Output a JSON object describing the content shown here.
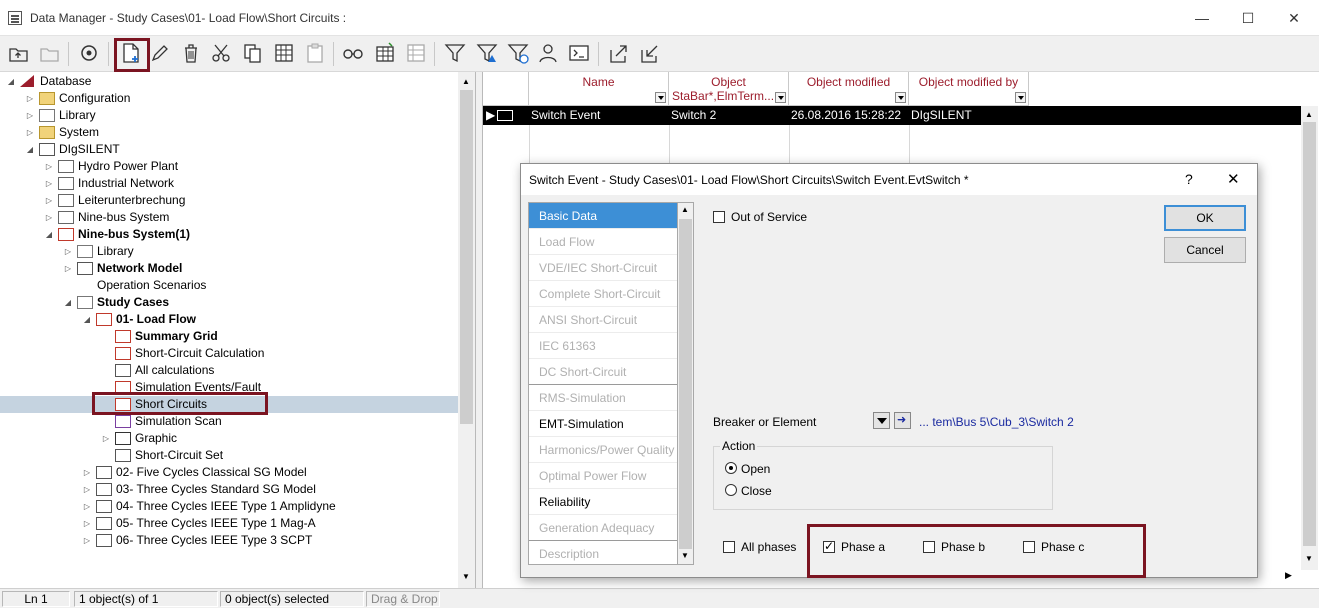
{
  "window": {
    "title": "Data Manager - Study Cases\\01- Load Flow\\Short Circuits :",
    "minimize": "—",
    "maximize": "☐",
    "close": "✕"
  },
  "toolbar_icons": [
    "folder-up-icon",
    "new-folder-icon",
    "refresh-icon",
    "new-object-icon",
    "edit-icon",
    "delete-icon",
    "cut-icon",
    "copy-icon",
    "paste-table-icon",
    "paste-icon",
    "glasses-icon",
    "table-icon",
    "grid-icon",
    "filter-icon",
    "filter-warning-icon",
    "filter-clock-icon",
    "users-icon",
    "terminal-icon",
    "export-icon",
    "import-icon"
  ],
  "tree": [
    {
      "label": "Database",
      "indent": 0,
      "expanded": true,
      "bold": false,
      "icon": "database-icon"
    },
    {
      "label": "Configuration",
      "indent": 1,
      "expanded": false,
      "bold": false,
      "icon": "folder-icon"
    },
    {
      "label": "Library",
      "indent": 1,
      "expanded": false,
      "bold": false,
      "icon": "library-icon"
    },
    {
      "label": "System",
      "indent": 1,
      "expanded": false,
      "bold": false,
      "icon": "folder-icon"
    },
    {
      "label": "DIgSILENT",
      "indent": 1,
      "expanded": true,
      "bold": false,
      "icon": "user-icon"
    },
    {
      "label": "Hydro Power Plant",
      "indent": 2,
      "expanded": false,
      "bold": false,
      "icon": "project-icon"
    },
    {
      "label": "Industrial Network",
      "indent": 2,
      "expanded": false,
      "bold": false,
      "icon": "project-icon"
    },
    {
      "label": "Leiterunterbrechung",
      "indent": 2,
      "expanded": false,
      "bold": false,
      "icon": "project-icon"
    },
    {
      "label": "Nine-bus System",
      "indent": 2,
      "expanded": false,
      "bold": false,
      "icon": "project-icon"
    },
    {
      "label": "Nine-bus System(1)",
      "indent": 2,
      "expanded": true,
      "bold": true,
      "icon": "active-project-icon"
    },
    {
      "label": "Library",
      "indent": 3,
      "expanded": false,
      "bold": false,
      "icon": "library-icon"
    },
    {
      "label": "Network Model",
      "indent": 3,
      "expanded": false,
      "bold": true,
      "icon": "network-model-icon"
    },
    {
      "label": "Operation Scenarios",
      "indent": 3,
      "expanded": null,
      "bold": false,
      "icon": "none"
    },
    {
      "label": "Study Cases",
      "indent": 3,
      "expanded": true,
      "bold": true,
      "icon": "study-cases-icon"
    },
    {
      "label": "01- Load Flow",
      "indent": 4,
      "expanded": true,
      "bold": true,
      "icon": "active-study-case-icon"
    },
    {
      "label": "Summary Grid",
      "indent": 5,
      "expanded": null,
      "bold": true,
      "icon": "summary-grid-icon"
    },
    {
      "label": "Short-Circuit Calculation",
      "indent": 5,
      "expanded": null,
      "bold": false,
      "icon": "short-circuit-icon"
    },
    {
      "label": "All calculations",
      "indent": 5,
      "expanded": null,
      "bold": false,
      "icon": "calculations-icon"
    },
    {
      "label": "Simulation Events/Fault",
      "indent": 5,
      "expanded": null,
      "bold": false,
      "icon": "events-icon"
    },
    {
      "label": "Short Circuits",
      "indent": 5,
      "expanded": null,
      "bold": false,
      "icon": "events-icon",
      "selected": true
    },
    {
      "label": "Simulation Scan",
      "indent": 5,
      "expanded": null,
      "bold": false,
      "icon": "scan-icon"
    },
    {
      "label": "Graphic",
      "indent": 5,
      "expanded": false,
      "bold": false,
      "icon": "graphic-icon"
    },
    {
      "label": "Short-Circuit Set",
      "indent": 5,
      "expanded": null,
      "bold": false,
      "icon": "set-icon"
    },
    {
      "label": "02- Five Cycles Classical SG Model",
      "indent": 4,
      "expanded": false,
      "bold": false,
      "icon": "study-case-icon"
    },
    {
      "label": "03- Three Cycles Standard SG Model",
      "indent": 4,
      "expanded": false,
      "bold": false,
      "icon": "study-case-icon"
    },
    {
      "label": "04- Three Cycles IEEE Type 1 Amplidyne",
      "indent": 4,
      "expanded": false,
      "bold": false,
      "icon": "study-case-icon"
    },
    {
      "label": "05- Three Cycles IEEE Type 1 Mag-A",
      "indent": 4,
      "expanded": false,
      "bold": false,
      "icon": "study-case-icon"
    },
    {
      "label": "06- Three Cycles IEEE Type 3 SCPT",
      "indent": 4,
      "expanded": false,
      "bold": false,
      "icon": "study-case-icon"
    }
  ],
  "list": {
    "columns": [
      {
        "title": "Name",
        "sub": ""
      },
      {
        "title": "Object",
        "sub": "StaBar*,ElmTerm..."
      },
      {
        "title": "Object modified",
        "sub": ""
      },
      {
        "title": "Object modified by",
        "sub": ""
      }
    ],
    "row": {
      "name": "Switch Event",
      "object": "Switch 2",
      "modified": "26.08.2016 15:28:22",
      "modified_by": "DIgSILENT"
    }
  },
  "status": {
    "line": "Ln 1",
    "count": "1 object(s) of 1",
    "selected": "0 object(s) selected",
    "mode": "Drag & Drop"
  },
  "dialog": {
    "title": "Switch Event - Study Cases\\01- Load Flow\\Short Circuits\\Switch Event.EvtSwitch *",
    "help": "?",
    "close": "✕",
    "nav": [
      {
        "label": "Basic Data",
        "state": "active"
      },
      {
        "label": "Load Flow",
        "state": "disabled"
      },
      {
        "label": "VDE/IEC Short-Circuit",
        "state": "disabled"
      },
      {
        "label": "Complete Short-Circuit",
        "state": "disabled"
      },
      {
        "label": "ANSI Short-Circuit",
        "state": "disabled"
      },
      {
        "label": "IEC 61363",
        "state": "disabled"
      },
      {
        "label": "DC Short-Circuit",
        "state": "disabled"
      },
      {
        "label": "RMS-Simulation",
        "state": "disabled"
      },
      {
        "label": "EMT-Simulation",
        "state": "enabled"
      },
      {
        "label": "Harmonics/Power Quality",
        "state": "disabled"
      },
      {
        "label": "Optimal Power Flow",
        "state": "disabled"
      },
      {
        "label": "Reliability",
        "state": "enabled"
      },
      {
        "label": "Generation Adequacy",
        "state": "disabled"
      },
      {
        "label": "Description",
        "state": "disabled"
      }
    ],
    "out_of_service": "Out of Service",
    "ok": "OK",
    "cancel": "Cancel",
    "breaker_label": "Breaker or Element",
    "breaker_value": "... tem\\Bus 5\\Cub_3\\Switch 2",
    "action_title": "Action",
    "action_open": "Open",
    "action_close": "Close",
    "all_phases": "All phases",
    "phase_a": "Phase a",
    "phase_b": "Phase b",
    "phase_c": "Phase c"
  },
  "colors": {
    "highlight": "#7b1421",
    "header_text": "#9c1d2c",
    "active_nav": "#3d8fd6",
    "link": "#1a2aa0"
  }
}
